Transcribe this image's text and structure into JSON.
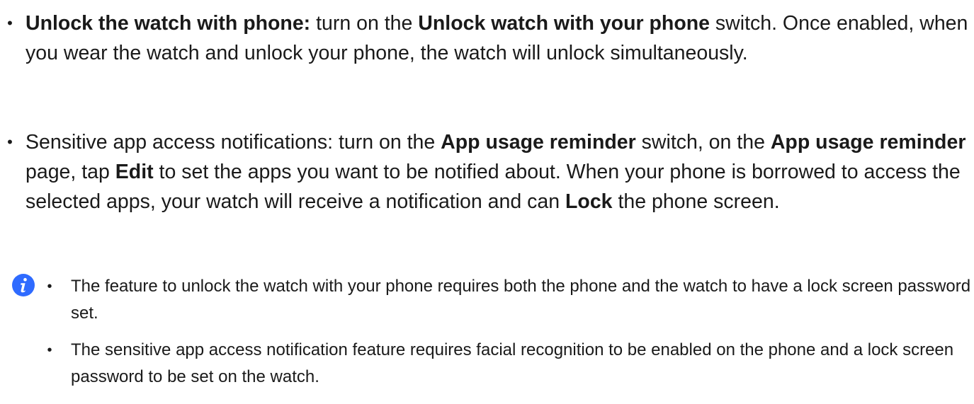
{
  "bullets": [
    {
      "marker": "•",
      "bold_1": "Unlock the watch with phone:",
      "text_1": " turn on the ",
      "bold_2": "Unlock watch with your phone",
      "text_2": " switch. Once enabled, when you wear the watch and unlock your phone, the watch will unlock simultaneously."
    },
    {
      "marker": "•",
      "text_1": "Sensitive app access notifications: turn on the ",
      "bold_1": "App usage reminder",
      "text_2": " switch, on the ",
      "bold_2": "App usage reminder",
      "text_3": " page, tap ",
      "bold_3": "Edit",
      "text_4": " to set the apps you want to be notified about. When your phone is borrowed to access the selected apps, your watch will receive a notification and can ",
      "bold_4": "Lock",
      "text_5": " the phone screen."
    }
  ],
  "note": {
    "icon": "info-icon",
    "icon_color": "#2f6bff",
    "items": [
      {
        "marker": "•",
        "text": "The feature to unlock the watch with your phone requires both the phone and the watch to have a lock screen password set."
      },
      {
        "marker": "•",
        "text": "The sensitive app access notification feature requires facial recognition to be enabled on the phone and a lock screen password to be set on the watch."
      }
    ]
  }
}
